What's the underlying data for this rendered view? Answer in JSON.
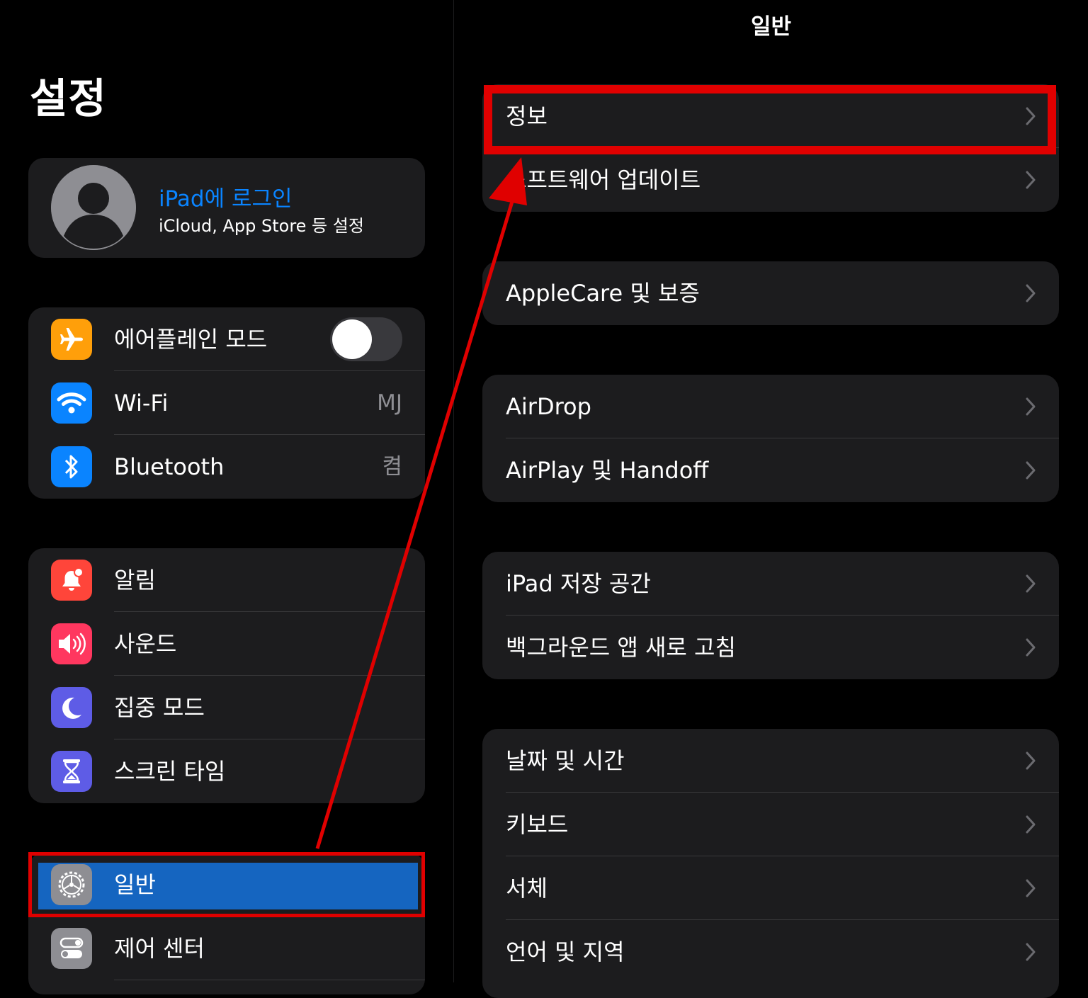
{
  "sidebar": {
    "title": "설정",
    "account": {
      "title": "iPad에 로그인",
      "subtitle": "iCloud, App Store 등 설정"
    },
    "group1": [
      {
        "label": "에어플레인 모드",
        "icon": "airplane-icon",
        "color": "#ff9f0a",
        "toggle": false
      },
      {
        "label": "Wi-Fi",
        "value": "MJ",
        "icon": "wifi-icon",
        "color": "#0a84ff"
      },
      {
        "label": "Bluetooth",
        "value": "켬",
        "icon": "bluetooth-icon",
        "color": "#0a84ff"
      }
    ],
    "group2": [
      {
        "label": "알림",
        "icon": "bell-icon",
        "color": "#ff453a"
      },
      {
        "label": "사운드",
        "icon": "speaker-icon",
        "color": "#ff375f"
      },
      {
        "label": "집중 모드",
        "icon": "moon-icon",
        "color": "#5e5ce6"
      },
      {
        "label": "스크린 타임",
        "icon": "hourglass-icon",
        "color": "#5e5ce6"
      }
    ],
    "group3": [
      {
        "label": "일반",
        "icon": "gear-icon",
        "color": "#8e8e93",
        "selected": true
      },
      {
        "label": "제어 센터",
        "icon": "switches-icon",
        "color": "#8e8e93"
      }
    ]
  },
  "detail": {
    "title": "일반",
    "groups": [
      [
        "정보",
        "소프트웨어 업데이트"
      ],
      [
        "AppleCare 및 보증"
      ],
      [
        "AirDrop",
        "AirPlay 및 Handoff"
      ],
      [
        "iPad 저장 공간",
        "백그라운드 앱 새로 고침"
      ],
      [
        "날짜 및 시간",
        "키보드",
        "서체",
        "언어 및 지역"
      ]
    ]
  },
  "annotation": {
    "color": "#e00000"
  }
}
